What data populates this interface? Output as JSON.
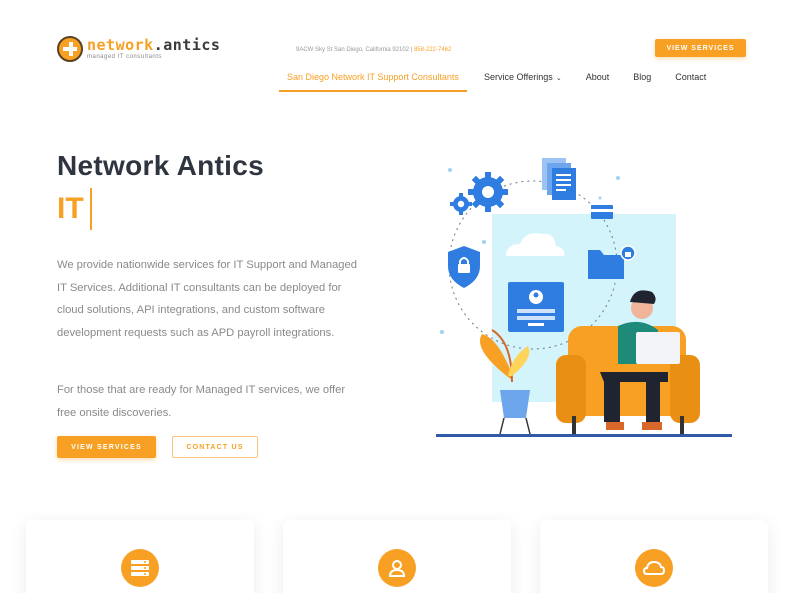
{
  "brand": {
    "name_part1": "network",
    "name_dot": ".",
    "name_part2": "antics",
    "tagline": "managed IT consultants"
  },
  "header": {
    "address": "9ACW Sky St San Diego, California 92102 |",
    "phone": "858-222-7462",
    "cta_label": "VIEW SERVICES"
  },
  "nav": {
    "items": [
      {
        "label": "San Diego Network IT Support Consultants"
      },
      {
        "label": "Service Offerings"
      },
      {
        "label": "About"
      },
      {
        "label": "Blog"
      },
      {
        "label": "Contact"
      }
    ]
  },
  "hero": {
    "title": "Network Antics",
    "typed_word": "IT",
    "paragraph1": "We provide nationwide services for IT Support and Managed IT Services. Additional IT consultants can be deployed for cloud solutions, API integrations, and custom software development requests such as APD payroll integrations.",
    "paragraph2": "For those that are ready for Managed IT services, we offer free onsite discoveries.",
    "primary_button": "VIEW SERVICES",
    "secondary_button": "CONTACT US"
  },
  "cards": [
    {
      "icon": "server-icon"
    },
    {
      "icon": "user-icon"
    },
    {
      "icon": "cloud-icon"
    }
  ],
  "colors": {
    "accent": "#f7a024",
    "blue": "#2f7de0",
    "heading": "#2e3440",
    "body_text": "#8a8a8a"
  }
}
